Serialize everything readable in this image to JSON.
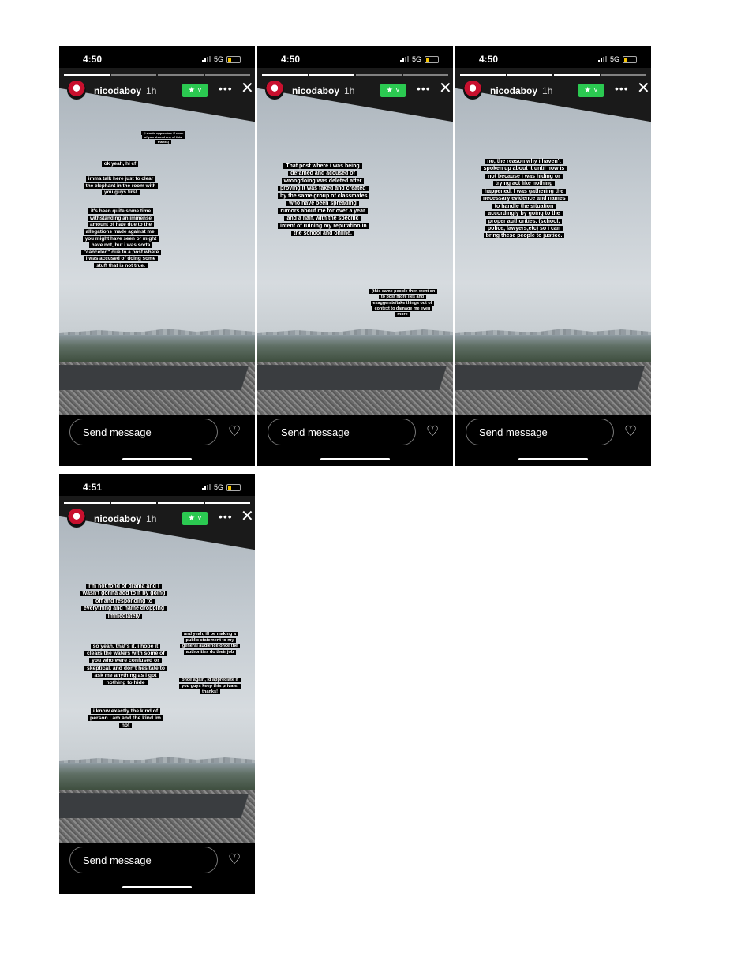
{
  "user": {
    "username": "nicodaboy",
    "age": "1h"
  },
  "ui": {
    "send_message_placeholder": "Send message",
    "network": "5G",
    "more_label": "•••",
    "close_label": "✕",
    "heart_label": "♡",
    "close_friends_label": "★ ˅"
  },
  "screens": [
    {
      "time": "4:50",
      "progress": [
        true,
        false,
        false,
        false
      ],
      "texts": [
        "(i would appreciate if none of you shared any of this, thanks)",
        "ok yeah, hi cf",
        "imma talk here just to clear the elephant in the room with you guys first",
        "it's been quite some time withstanding an immense amount of hate due to the allegations made against me. you might have seen or might have not, but i was sorta \"canceled\" due to a post where i was accused of doing some stuff that is not true."
      ]
    },
    {
      "time": "4:50",
      "progress": [
        true,
        true,
        false,
        false
      ],
      "texts": [
        "That post where i was being defamed and accused of wrongdoing was deleted after proving it was faked and created by the same group of classmates who have been spreading rumors about me for over a year and a half, with the specific intent of ruining my reputation in the school and online.",
        "(this same people then went on to post more lies and exaggerate/take things out of context to damage me even more"
      ]
    },
    {
      "time": "4:50",
      "progress": [
        true,
        true,
        true,
        false
      ],
      "texts": [
        "no, the reason why i haven't spoken up about it until now is not because i was hiding or trying act like nothing happened. I was gathering the necessary evidence and names to handle the situation accordingly by going to the proper authorities. (school, police, lawyers,etc) so i can bring these people to justice."
      ]
    },
    {
      "time": "4:51",
      "progress": [
        true,
        true,
        true,
        true
      ],
      "texts": [
        "i'm not fond of drama and i wasn't gonna add to it by going off and responding to everything and name dropping immediately",
        "so yeah, that's it. i hope it clears the waters with some of you who were confused or skeptical, and don't hesitate to ask me anything as i got nothing to hide",
        "i know exactly the kind of person i am and the kind im not",
        "and yeah, ill be making a public statement to my general audience once the authorities do their job",
        "once again, id appreciate if you guys keep this private. thanks!"
      ]
    }
  ]
}
